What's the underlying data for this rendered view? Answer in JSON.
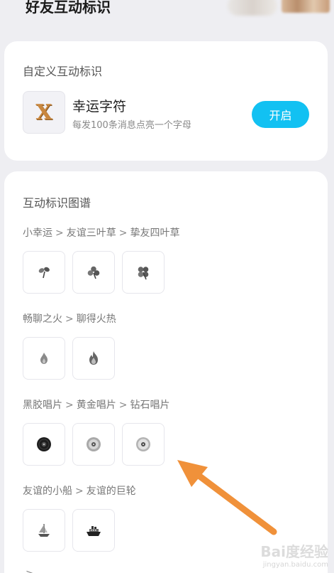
{
  "header": {
    "title": "好友互动标识"
  },
  "custom": {
    "section_title": "自定义互动标识",
    "badge_letter": "X",
    "name": "幸运字符",
    "description": "每发100条消息点亮一个字母",
    "open_label": "开启"
  },
  "map": {
    "section_title": "互动标识图谱",
    "separator": ">",
    "groups": [
      {
        "stages": [
          "小幸运",
          "友谊三叶草",
          "挚友四叶草"
        ],
        "icons": [
          "two-leaf-sprout-icon",
          "three-leaf-clover-icon",
          "four-leaf-clover-icon"
        ]
      },
      {
        "stages": [
          "畅聊之火",
          "聊得火热"
        ],
        "icons": [
          "small-flame-icon",
          "big-flame-icon"
        ]
      },
      {
        "stages": [
          "黑胶唱片",
          "黄金唱片",
          "钻石唱片"
        ],
        "icons": [
          "vinyl-record-icon",
          "gold-record-icon",
          "diamond-record-icon"
        ]
      },
      {
        "stages": [
          "友谊的小船",
          "友谊的巨轮"
        ],
        "icons": [
          "sailboat-icon",
          "steamship-icon"
        ]
      },
      {
        "stages": [
          "",
          ""
        ],
        "icons": []
      }
    ]
  },
  "colors": {
    "accent": "#12c1f2",
    "arrow": "#f0913a",
    "badge_gold": "#c9873f"
  },
  "watermark": {
    "brand": "Bai度经验",
    "url": "jingyan.baidu.com"
  }
}
